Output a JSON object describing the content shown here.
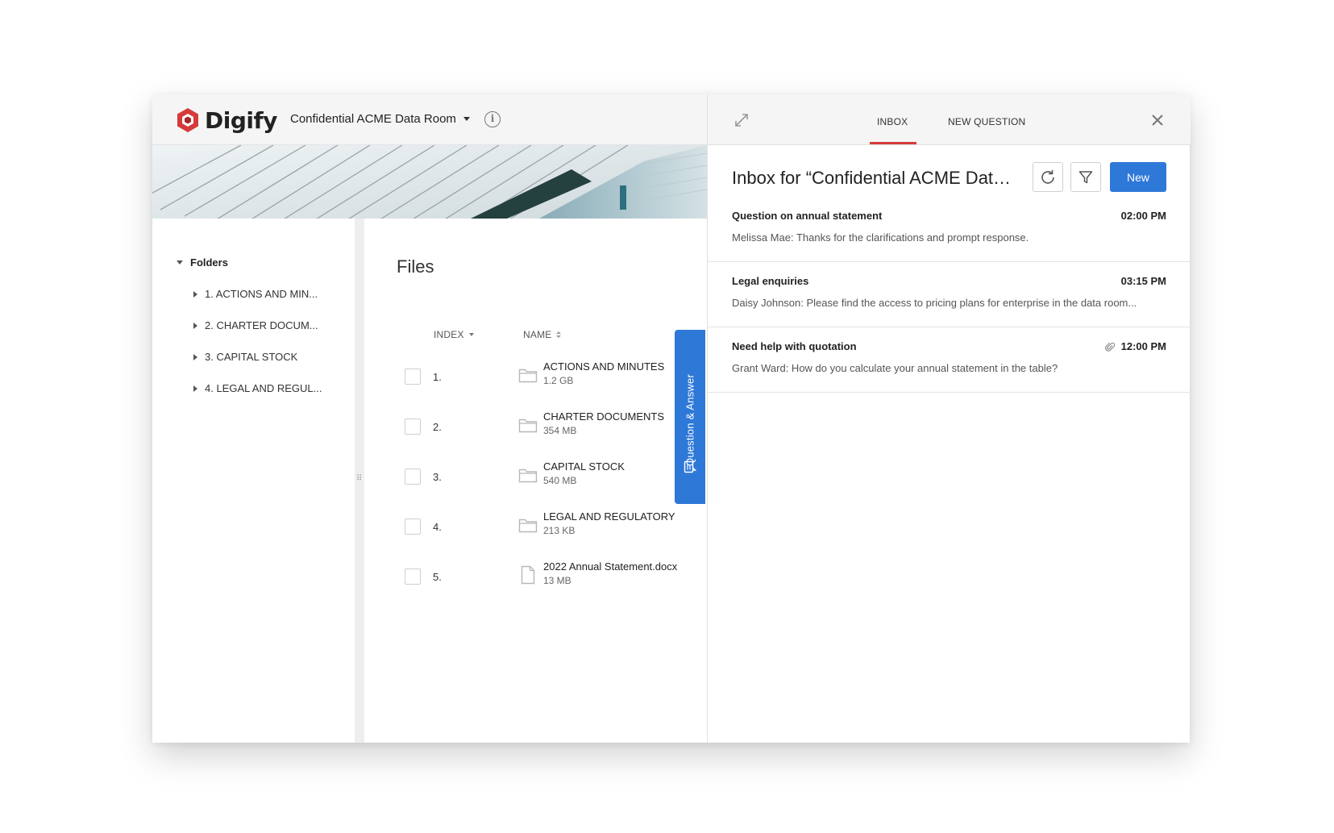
{
  "header": {
    "brand": "Digify",
    "room_title": "Confidential ACME Data Room"
  },
  "sidebar": {
    "folders_label": "Folders",
    "items": [
      {
        "label": "1. ACTIONS AND MIN..."
      },
      {
        "label": "2.  CHARTER DOCUM..."
      },
      {
        "label": "3. CAPITAL STOCK"
      },
      {
        "label": "4. LEGAL AND REGUL..."
      }
    ]
  },
  "main": {
    "title": "Files",
    "columns": {
      "index": "INDEX",
      "name": "NAME"
    },
    "rows": [
      {
        "index": "1.",
        "name": "ACTIONS AND MINUTES",
        "size": "1.2 GB",
        "type": "folder"
      },
      {
        "index": "2.",
        "name": "CHARTER DOCUMENTS",
        "size": "354 MB",
        "type": "folder"
      },
      {
        "index": "3.",
        "name": "CAPITAL STOCK",
        "size": "540 MB",
        "type": "folder"
      },
      {
        "index": "4.",
        "name": "LEGAL AND REGULATORY",
        "size": "213 KB",
        "type": "folder"
      },
      {
        "index": "5.",
        "name": "2022 Annual Statement.docx",
        "size": "13 MB",
        "type": "file"
      }
    ]
  },
  "qa_tab": {
    "label": "Question & Answer"
  },
  "panel": {
    "tabs": [
      {
        "label": "INBOX",
        "active": true
      },
      {
        "label": "NEW QUESTION",
        "active": false
      }
    ],
    "inbox_title": "Inbox for “Confidential ACME Data Room”",
    "new_button": "New",
    "messages": [
      {
        "subject": "Question on annual statement",
        "time": "02:00 PM",
        "body": "Melissa Mae: Thanks for the clarifications and prompt response.",
        "attachment": false
      },
      {
        "subject": "Legal enquiries",
        "time": "03:15 PM",
        "body": "Daisy Johnson: Please find the access to pricing plans for enterprise in the data room...",
        "attachment": false
      },
      {
        "subject": "Need help with quotation",
        "time": "12:00 PM",
        "body": "Grant Ward: How do you calculate your annual statement in the table?",
        "attachment": true
      }
    ]
  },
  "colors": {
    "accent": "#2e78d8",
    "brand_red": "#d63b3b",
    "tab_underline": "#d63b3b"
  },
  "icons": [
    "digify-logo-icon",
    "info-icon",
    "expand-icon",
    "close-icon",
    "refresh-icon",
    "filter-icon",
    "folder-icon",
    "file-icon",
    "attachment-icon",
    "qa-icon"
  ]
}
